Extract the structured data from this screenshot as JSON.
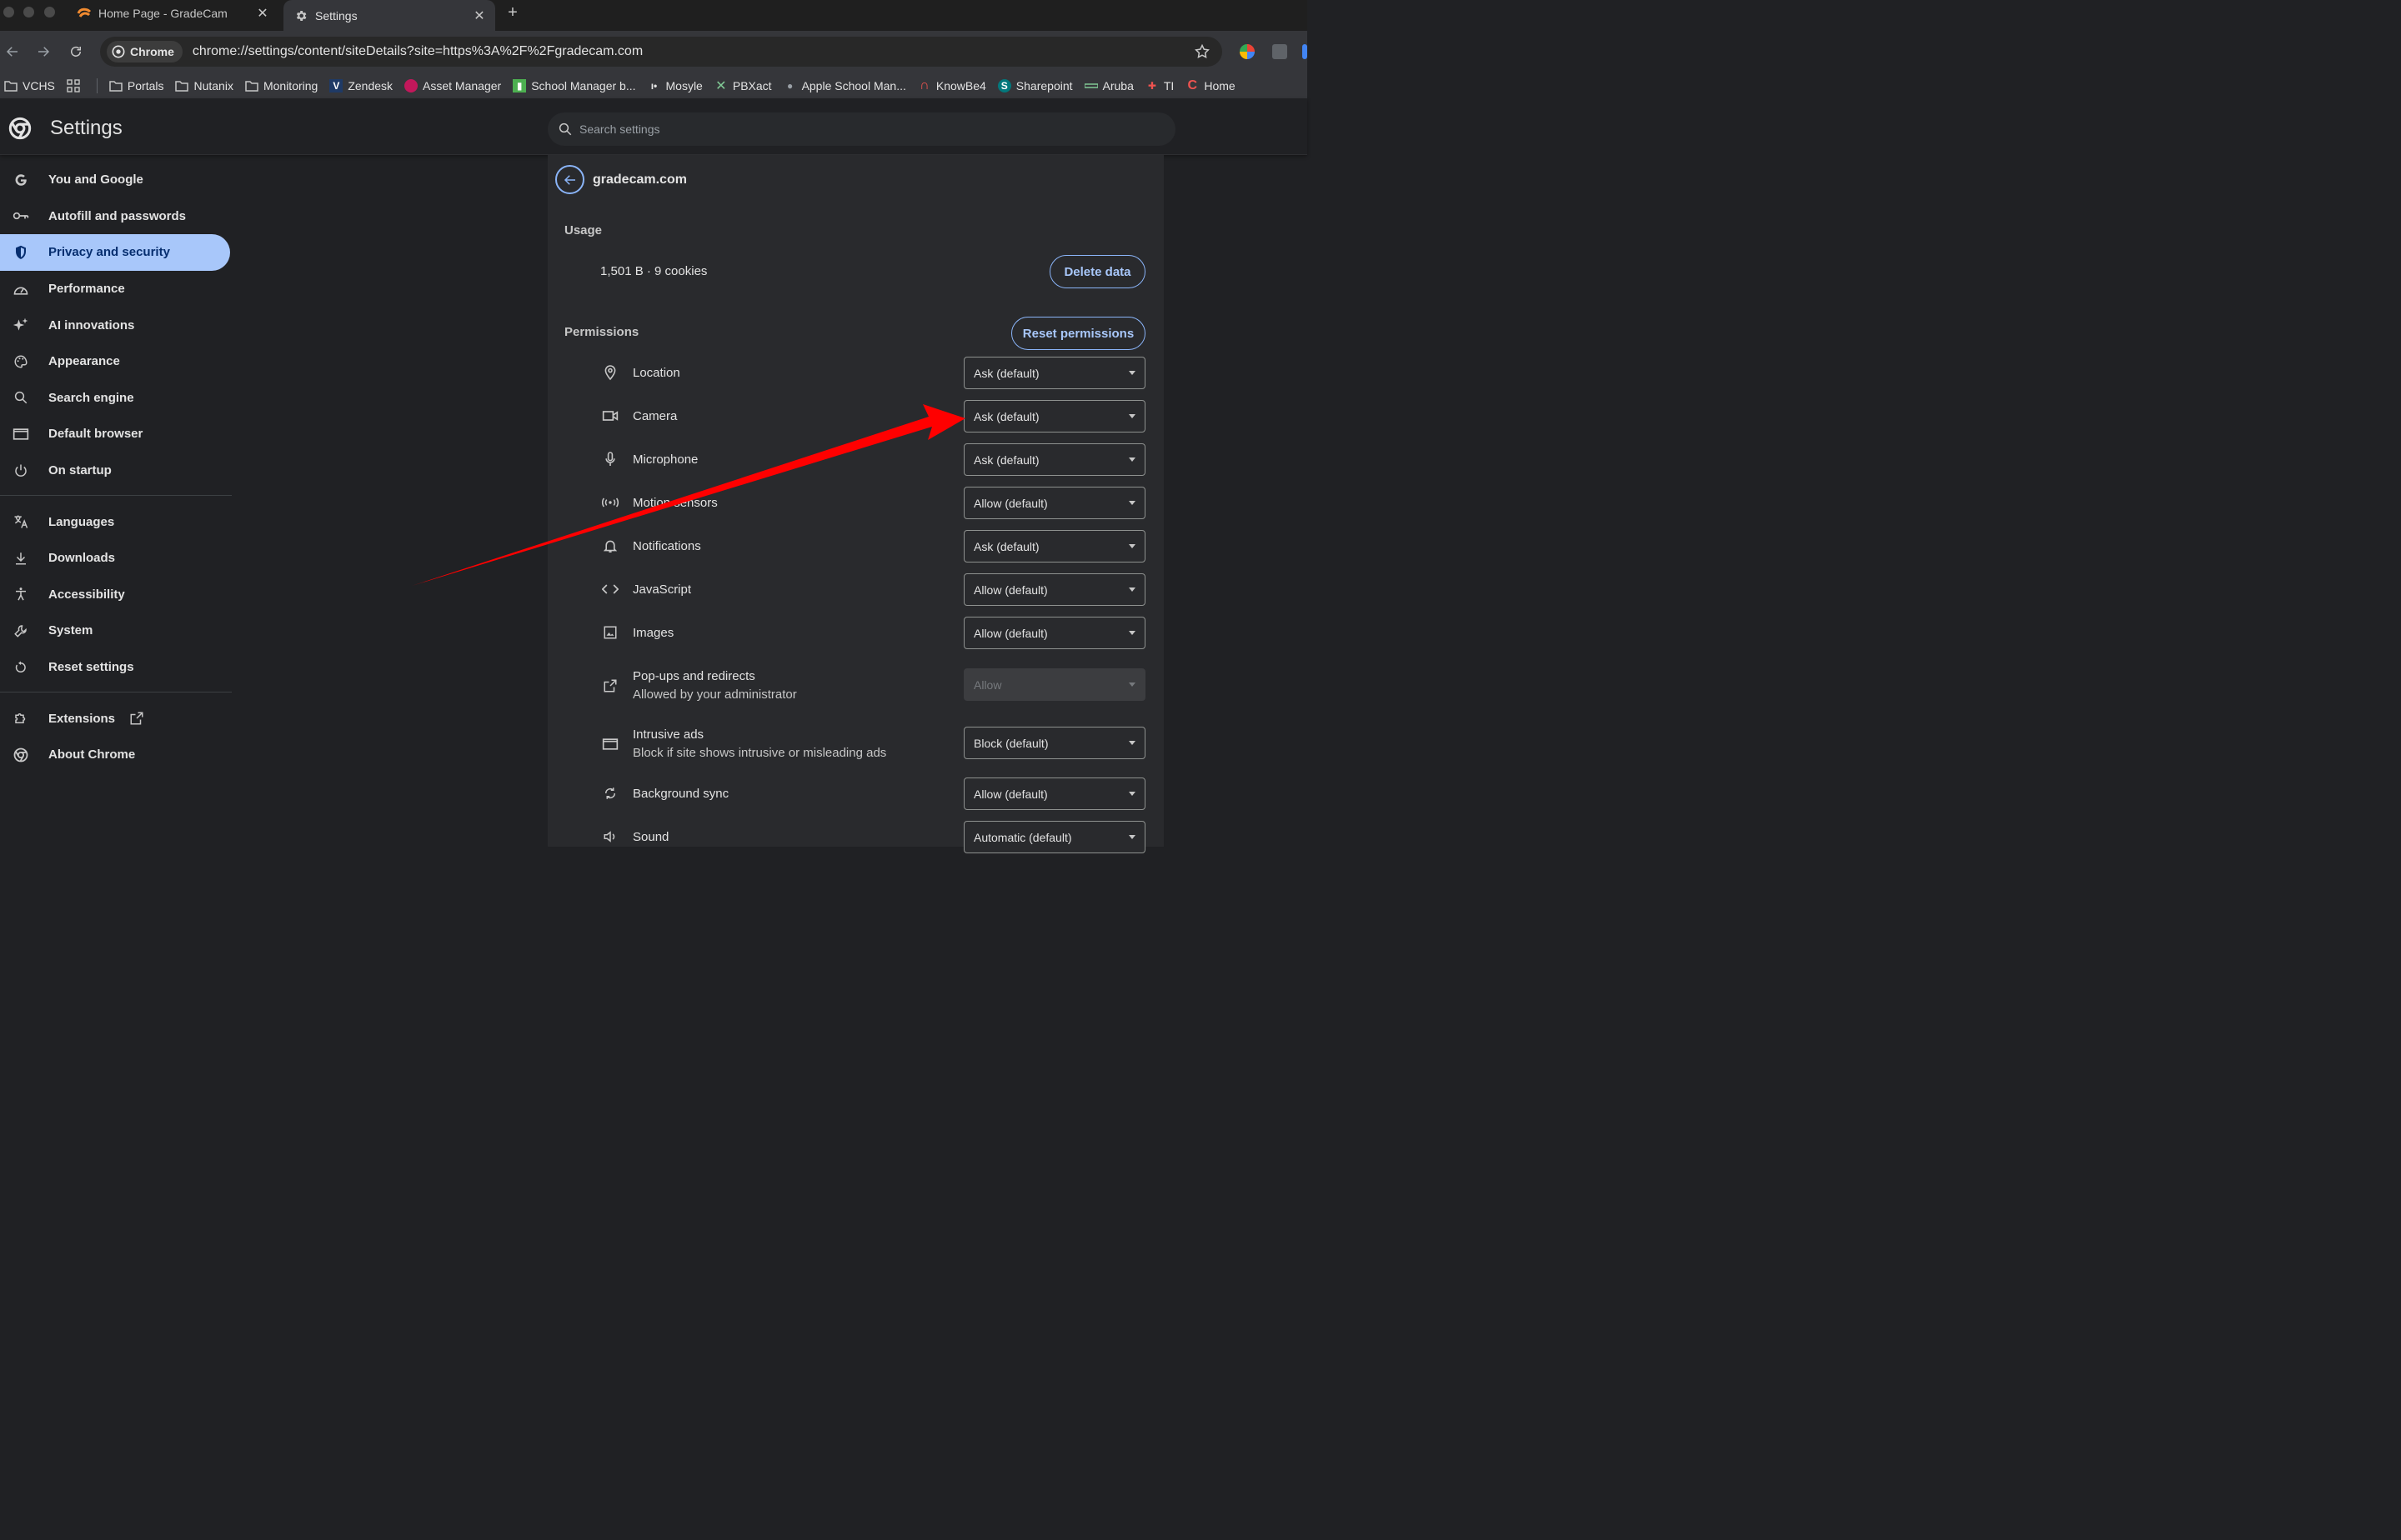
{
  "browser": {
    "tabs": [
      {
        "title": "Home Page - GradeCam",
        "active": false
      },
      {
        "title": "Settings",
        "active": true
      }
    ],
    "omnibox": {
      "chip_label": "Chrome",
      "url": "chrome://settings/content/siteDetails?site=https%3A%2F%2Fgradecam.com"
    },
    "bookmarks": [
      {
        "label": "VCHS",
        "icon": "folder-link-icon"
      },
      {
        "label": "",
        "icon": "apps-grid-icon"
      },
      {
        "label": "Portals",
        "icon": "folder-icon"
      },
      {
        "label": "Nutanix",
        "icon": "folder-icon"
      },
      {
        "label": "Monitoring",
        "icon": "folder-icon"
      },
      {
        "label": "Zendesk",
        "icon": "zendesk-icon"
      },
      {
        "label": "Asset Manager",
        "icon": "asset-manager-icon"
      },
      {
        "label": "School Manager b...",
        "icon": "school-manager-icon"
      },
      {
        "label": "Mosyle",
        "icon": "mosyle-icon"
      },
      {
        "label": "PBXact",
        "icon": "pbxact-icon"
      },
      {
        "label": "Apple School Man...",
        "icon": "apple-icon"
      },
      {
        "label": "KnowBe4",
        "icon": "knowbe4-icon"
      },
      {
        "label": "Sharepoint",
        "icon": "sharepoint-icon"
      },
      {
        "label": "Aruba",
        "icon": "aruba-icon"
      },
      {
        "label": "TI",
        "icon": "ti-icon"
      },
      {
        "label": "Home",
        "icon": "home-icon"
      }
    ]
  },
  "settings": {
    "title": "Settings",
    "search_placeholder": "Search settings"
  },
  "sidebar": {
    "group1": [
      {
        "label": "You and Google",
        "icon": "google-icon",
        "selected": false
      },
      {
        "label": "Autofill and passwords",
        "icon": "key-icon",
        "selected": false
      },
      {
        "label": "Privacy and security",
        "icon": "shield-icon",
        "selected": true
      },
      {
        "label": "Performance",
        "icon": "speedometer-icon",
        "selected": false
      },
      {
        "label": "AI innovations",
        "icon": "sparkle-icon",
        "selected": false
      },
      {
        "label": "Appearance",
        "icon": "palette-icon",
        "selected": false
      },
      {
        "label": "Search engine",
        "icon": "search-icon",
        "selected": false
      },
      {
        "label": "Default browser",
        "icon": "browser-window-icon",
        "selected": false
      },
      {
        "label": "On startup",
        "icon": "power-icon",
        "selected": false
      }
    ],
    "group2": [
      {
        "label": "Languages",
        "icon": "translate-icon"
      },
      {
        "label": "Downloads",
        "icon": "download-icon"
      },
      {
        "label": "Accessibility",
        "icon": "accessibility-icon"
      },
      {
        "label": "System",
        "icon": "wrench-icon"
      },
      {
        "label": "Reset settings",
        "icon": "reset-icon"
      }
    ],
    "group3": [
      {
        "label": "Extensions",
        "icon": "puzzle-icon"
      },
      {
        "label": "About Chrome",
        "icon": "chrome-icon"
      }
    ]
  },
  "site": {
    "name": "gradecam.com",
    "usage_label": "Usage",
    "usage_value": "1,501 B · 9 cookies",
    "delete_label": "Delete data",
    "permissions_label": "Permissions",
    "reset_label": "Reset permissions",
    "permissions": [
      {
        "name": "Location",
        "sub": "",
        "value": "Ask (default)",
        "icon": "location-pin-icon",
        "disabled": false
      },
      {
        "name": "Camera",
        "sub": "",
        "value": "Ask (default)",
        "icon": "camera-icon",
        "disabled": false
      },
      {
        "name": "Microphone",
        "sub": "",
        "value": "Ask (default)",
        "icon": "microphone-icon",
        "disabled": false
      },
      {
        "name": "Motion sensors",
        "sub": "",
        "value": "Allow (default)",
        "icon": "sensors-icon",
        "disabled": false
      },
      {
        "name": "Notifications",
        "sub": "",
        "value": "Ask (default)",
        "icon": "bell-icon",
        "disabled": false
      },
      {
        "name": "JavaScript",
        "sub": "",
        "value": "Allow (default)",
        "icon": "code-icon",
        "disabled": false
      },
      {
        "name": "Images",
        "sub": "",
        "value": "Allow (default)",
        "icon": "image-icon",
        "disabled": false
      },
      {
        "name": "Pop-ups and redirects",
        "sub": "Allowed by your administrator",
        "value": "Allow",
        "icon": "popup-icon",
        "disabled": true
      },
      {
        "name": "Intrusive ads",
        "sub": "Block if site shows intrusive or misleading ads",
        "value": "Block (default)",
        "icon": "ads-icon",
        "disabled": false
      },
      {
        "name": "Background sync",
        "sub": "",
        "value": "Allow (default)",
        "icon": "sync-icon",
        "disabled": false
      },
      {
        "name": "Sound",
        "sub": "",
        "value": "Automatic (default)",
        "icon": "sound-icon",
        "disabled": false
      }
    ]
  },
  "colors": {
    "accent": "#a8c7fa",
    "link": "#8ab4f8",
    "annotation": "#ff0000"
  }
}
